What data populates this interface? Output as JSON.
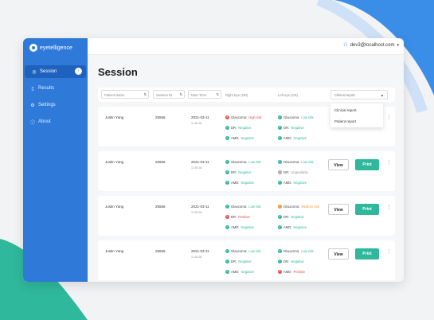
{
  "app": {
    "logo_text": "eyetelligence"
  },
  "topbar": {
    "user_email": "dev3@localhost.com"
  },
  "sidebar": {
    "items": [
      {
        "label": "Session",
        "icon": "eye-icon"
      },
      {
        "label": "Results",
        "icon": "document-icon"
      },
      {
        "label": "Settings",
        "icon": "gear-icon"
      },
      {
        "label": "About",
        "icon": "info-icon"
      }
    ]
  },
  "page": {
    "title": "Session"
  },
  "filters": {
    "patient_name": "Patient Name",
    "session_id": "Session ID",
    "date_time": "Date Time",
    "right_eye": "Right Eye (OD)",
    "left_eye": "Left eye (OS)",
    "clinical_report": "Clinical report"
  },
  "dropdown": {
    "options": [
      "Clinical report",
      "Patient report"
    ]
  },
  "buttons": {
    "view": "View",
    "print": "Print"
  },
  "rows": [
    {
      "name": "Justin Yang",
      "session_id": "25556",
      "date": "2021-03-11",
      "time": "11:55:36",
      "od": {
        "glaucoma": "High risk",
        "dr": "Negative",
        "amd": "Negative"
      },
      "os": {
        "glaucoma": "Low risk",
        "dr": "Negative",
        "amd": "Negative"
      }
    },
    {
      "name": "Justin Yang",
      "session_id": "25556",
      "date": "2021-03-11",
      "time": "11:55:36",
      "od": {
        "glaucoma": "Low risk",
        "dr": "Negative",
        "amd": "Negative"
      },
      "os": {
        "glaucoma": "Low risk",
        "dr": "Ungradable",
        "amd": "Negative"
      }
    },
    {
      "name": "Justin Yang",
      "session_id": "25556",
      "date": "2021-03-11",
      "time": "11:55:36",
      "od": {
        "glaucoma": "Low risk",
        "dr": "Positive",
        "amd": "Negative"
      },
      "os": {
        "glaucoma": "Medium risk",
        "dr": "Negative",
        "amd": "Negative"
      }
    },
    {
      "name": "Justin Yang",
      "session_id": "25556",
      "date": "2021-03-11",
      "time": "11:55:36",
      "od": {
        "glaucoma": "Low risk",
        "dr": "Negative",
        "amd": "Negative"
      },
      "os": {
        "glaucoma": "Low risk",
        "dr": "Negative",
        "amd": "Positive"
      }
    }
  ],
  "labels": {
    "glaucoma": "Glaucoma:",
    "dr": "DR:",
    "amd": "AMD:"
  },
  "colors": {
    "brand": "#2f7ad9",
    "positive_action": "#2fb89c",
    "risk_high": "#e44b4b",
    "risk_medium": "#f19a38"
  }
}
